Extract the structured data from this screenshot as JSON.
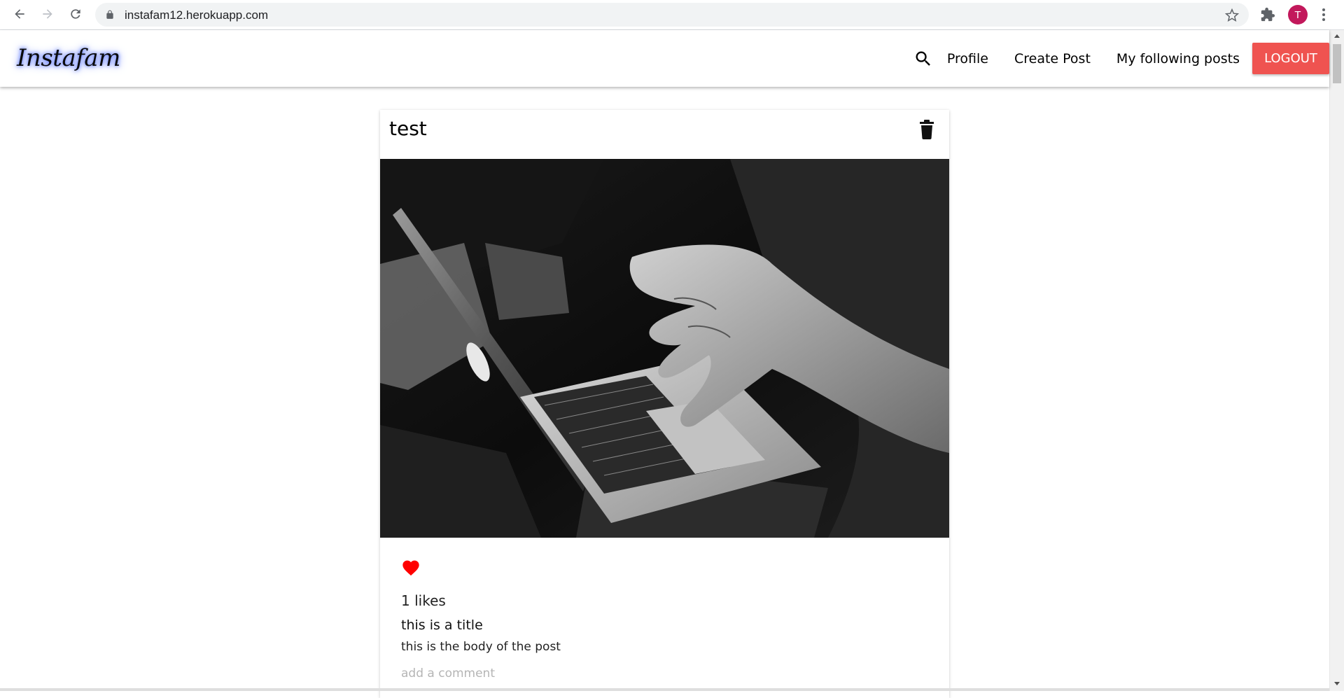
{
  "browser": {
    "url": "instafam12.herokuapp.com",
    "profile_initial": "T",
    "profile_color": "#c2185b"
  },
  "nav": {
    "brand": "Instafam",
    "links": [
      "Profile",
      "Create Post",
      "My following posts"
    ],
    "logout_label": "LOGOUT",
    "logout_color": "#ef5350"
  },
  "post": {
    "author": "test",
    "likes_text": "1 likes",
    "title": "this is a title",
    "body": "this is the body of the post",
    "comment_placeholder": "add a comment",
    "heart_color": "#ff0000",
    "image_description_icon": "laptop-photo"
  }
}
